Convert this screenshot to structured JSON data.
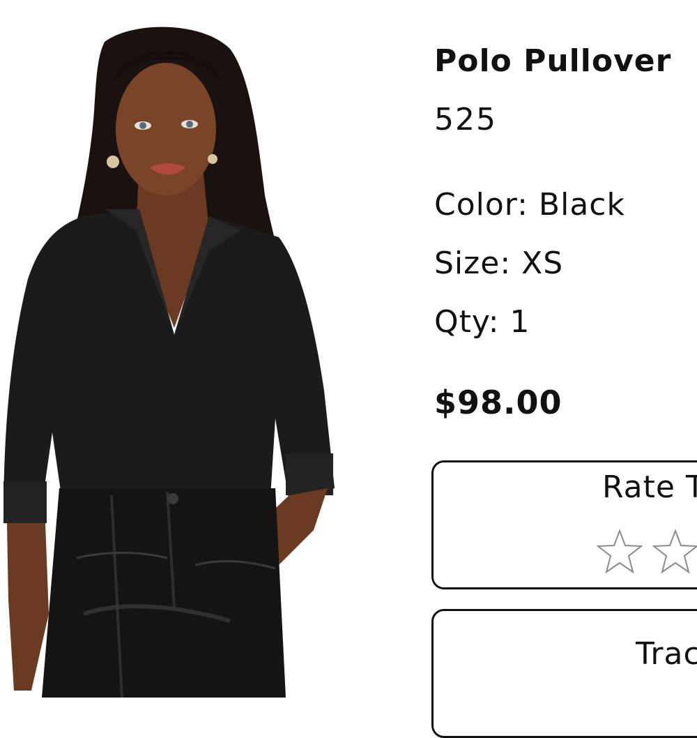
{
  "product": {
    "name": "Polo Pullover",
    "sku": "525",
    "color_text": "Color: Black",
    "size_text": "Size: XS",
    "qty_text": "Qty: 1",
    "price": "$98.00",
    "image_icon": "product-photo-woman-black-polo-pullover"
  },
  "rating": {
    "label": "Rate T",
    "stars_visible": 2,
    "star_icon": "star-outline-icon"
  },
  "track": {
    "label": "Trac"
  },
  "colors": {
    "text": "#111111",
    "border": "#111111",
    "star_outline": "#8a8a8a",
    "background": "#ffffff"
  }
}
